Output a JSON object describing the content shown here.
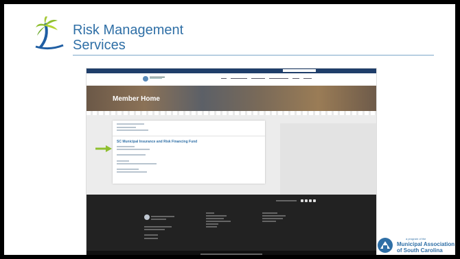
{
  "header": {
    "title_line1": "Risk Management",
    "title_line2": "Services"
  },
  "site": {
    "hero_title": "Member Home",
    "panel_heading": "SC Municipal Insurance and Risk Financing Fund"
  },
  "branding": {
    "tagline": "a program of the",
    "org_line1": "Municipal Association",
    "org_line2": "of South Carolina"
  },
  "colors": {
    "brand_blue": "#2f6fa6",
    "arrow_green": "#8fbf2f",
    "footer_dark": "#222222"
  }
}
